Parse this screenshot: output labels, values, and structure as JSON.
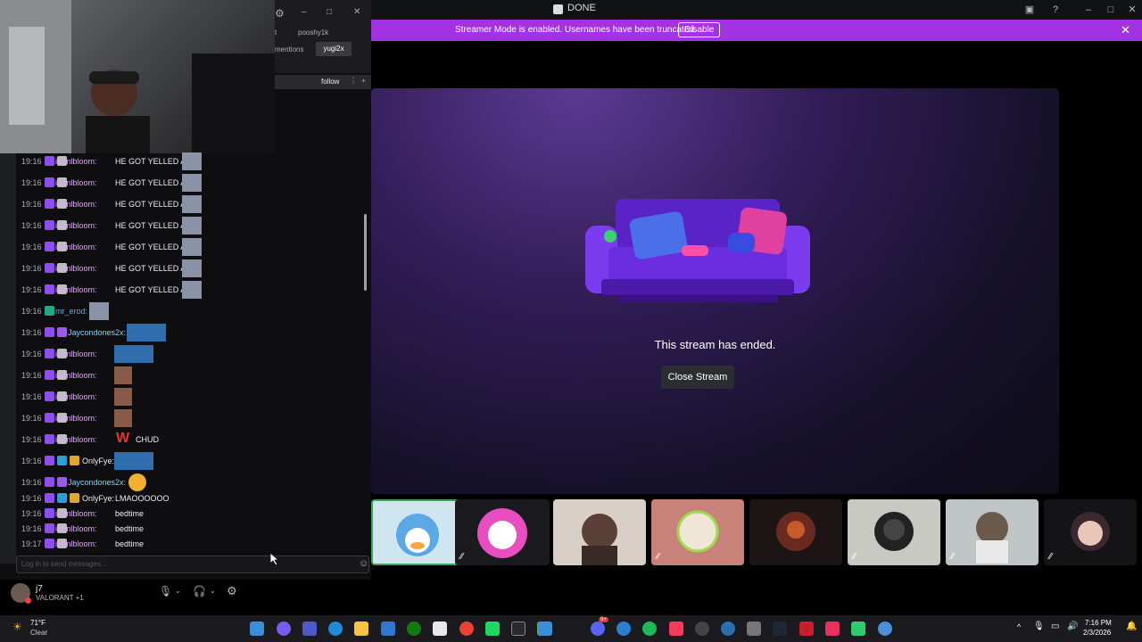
{
  "discord": {
    "window_title": "DONE",
    "streamer_banner": "Streamer Mode is enabled. Usernames have been truncated.",
    "disable_label": "Disable",
    "stream_ended_text": "This stream has ended.",
    "close_stream_label": "Close Stream"
  },
  "chat": {
    "tabs": [
      "t",
      "pooshy1k"
    ],
    "tabs2": [
      "mentions",
      "yugi2x"
    ],
    "follow_label": "follow",
    "input_placeholder": "Log in to send messages...",
    "messages": [
      {
        "time": "19:16",
        "user": "intrnlbloom:",
        "text": "HE GOT YELLED AT"
      },
      {
        "time": "19:16",
        "user": "intrnlbloom:",
        "text": "HE GOT YELLED AT"
      },
      {
        "time": "19:16",
        "user": "intrnlbloom:",
        "text": "HE GOT YELLED AT"
      },
      {
        "time": "19:16",
        "user": "intrnlbloom:",
        "text": "HE GOT YELLED AT"
      },
      {
        "time": "19:16",
        "user": "intrnlbloom:",
        "text": "HE GOT YELLED AT"
      },
      {
        "time": "19:16",
        "user": "intrnlbloom:",
        "text": "HE GOT YELLED AT"
      },
      {
        "time": "19:16",
        "user": "intrnlbloom:",
        "text": "HE GOT YELLED AT"
      },
      {
        "time": "19:16",
        "user": "mr_erod:",
        "text": ""
      },
      {
        "time": "19:16",
        "user": "Jaycondones2x:",
        "text": ""
      },
      {
        "time": "19:16",
        "user": "intrnlbloom:",
        "text": ""
      },
      {
        "time": "19:16",
        "user": "intrnlbloom:",
        "text": ""
      },
      {
        "time": "19:16",
        "user": "intrnlbloom:",
        "text": ""
      },
      {
        "time": "19:16",
        "user": "intrnlbloom:",
        "text": ""
      },
      {
        "time": "19:16",
        "user": "intrnlbloom:",
        "text": "CHUD"
      },
      {
        "time": "19:16",
        "user": "OnlyFye:",
        "text": ""
      },
      {
        "time": "19:16",
        "user": "Jaycondones2x:",
        "text": ""
      },
      {
        "time": "19:16",
        "user": "OnlyFye:",
        "text": "LMAOOOOOO"
      },
      {
        "time": "19:16",
        "user": "intrnlbloom:",
        "text": "bedtime"
      },
      {
        "time": "19:16",
        "user": "intrnlbloom:",
        "text": "bedtime"
      },
      {
        "time": "19:17",
        "user": "intrnlbloom:",
        "text": "bedtime"
      }
    ],
    "chud_emote": "W"
  },
  "user": {
    "name": "j7",
    "status": "VALORANT +1"
  },
  "taskbar": {
    "weather_temp": "71°F",
    "weather_desc": "Clear",
    "time": "7:16 PM",
    "date": "2/3/2026",
    "badge": "9+"
  }
}
